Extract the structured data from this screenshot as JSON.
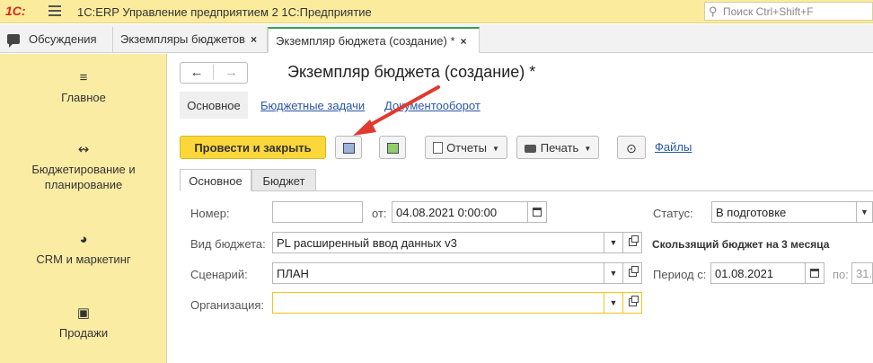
{
  "titlebar": {
    "logo": "1С:",
    "app_title": "1С:ERP Управление предприятием 2 1С:Предприятие",
    "search_placeholder": "Поиск Ctrl+Shift+F"
  },
  "tabs": [
    {
      "label": "Обсуждения",
      "closable": false,
      "active": false
    },
    {
      "label": "Экземпляры бюджетов",
      "closable": true,
      "active": false
    },
    {
      "label": "Экземпляр бюджета (создание) *",
      "closable": true,
      "active": true
    }
  ],
  "close_glyph": "×",
  "sidebar": {
    "items": [
      {
        "label": "Главное",
        "icon": "menu-icon"
      },
      {
        "label": "Бюджетирование и планирование",
        "icon": "budget-chart-icon"
      },
      {
        "label": "CRM и маркетинг",
        "icon": "pie-icon"
      },
      {
        "label": "Продажи",
        "icon": "bag-icon"
      }
    ]
  },
  "document": {
    "title": "Экземпляр бюджета (создание) *",
    "sections": [
      "Основное",
      "Бюджетные задачи",
      "Документооборот"
    ]
  },
  "toolbar": {
    "post_close": "Провести и закрыть",
    "reports": "Отчеты",
    "print": "Печать",
    "files": "Файлы"
  },
  "form_tabs": [
    "Основное",
    "Бюджет"
  ],
  "form": {
    "number_label": "Номер:",
    "number_value": "",
    "from_label": "от:",
    "date_value": "04.08.2021  0:00:00",
    "status_label": "Статус:",
    "status_value": "В подготовке",
    "budget_type_label": "Вид бюджета:",
    "budget_type_value": "PL расширенный ввод данных v3",
    "rolling_note": "Скользящий бюджет на 3 месяца",
    "scenario_label": "Сценарий:",
    "scenario_value": "ПЛАН",
    "period_label": "Период с:",
    "period_from": "01.08.2021",
    "period_to_label": "по:",
    "period_to": "31.",
    "org_label": "Организация:",
    "org_value": ""
  },
  "colors": {
    "titlebar": "#fbeb9c",
    "sidebar": "#fbeca4",
    "primary_button": "#fbd73a",
    "active_tab_accent": "#3c9b54",
    "link": "#2a56a8",
    "arrow": "#e03a2f"
  }
}
